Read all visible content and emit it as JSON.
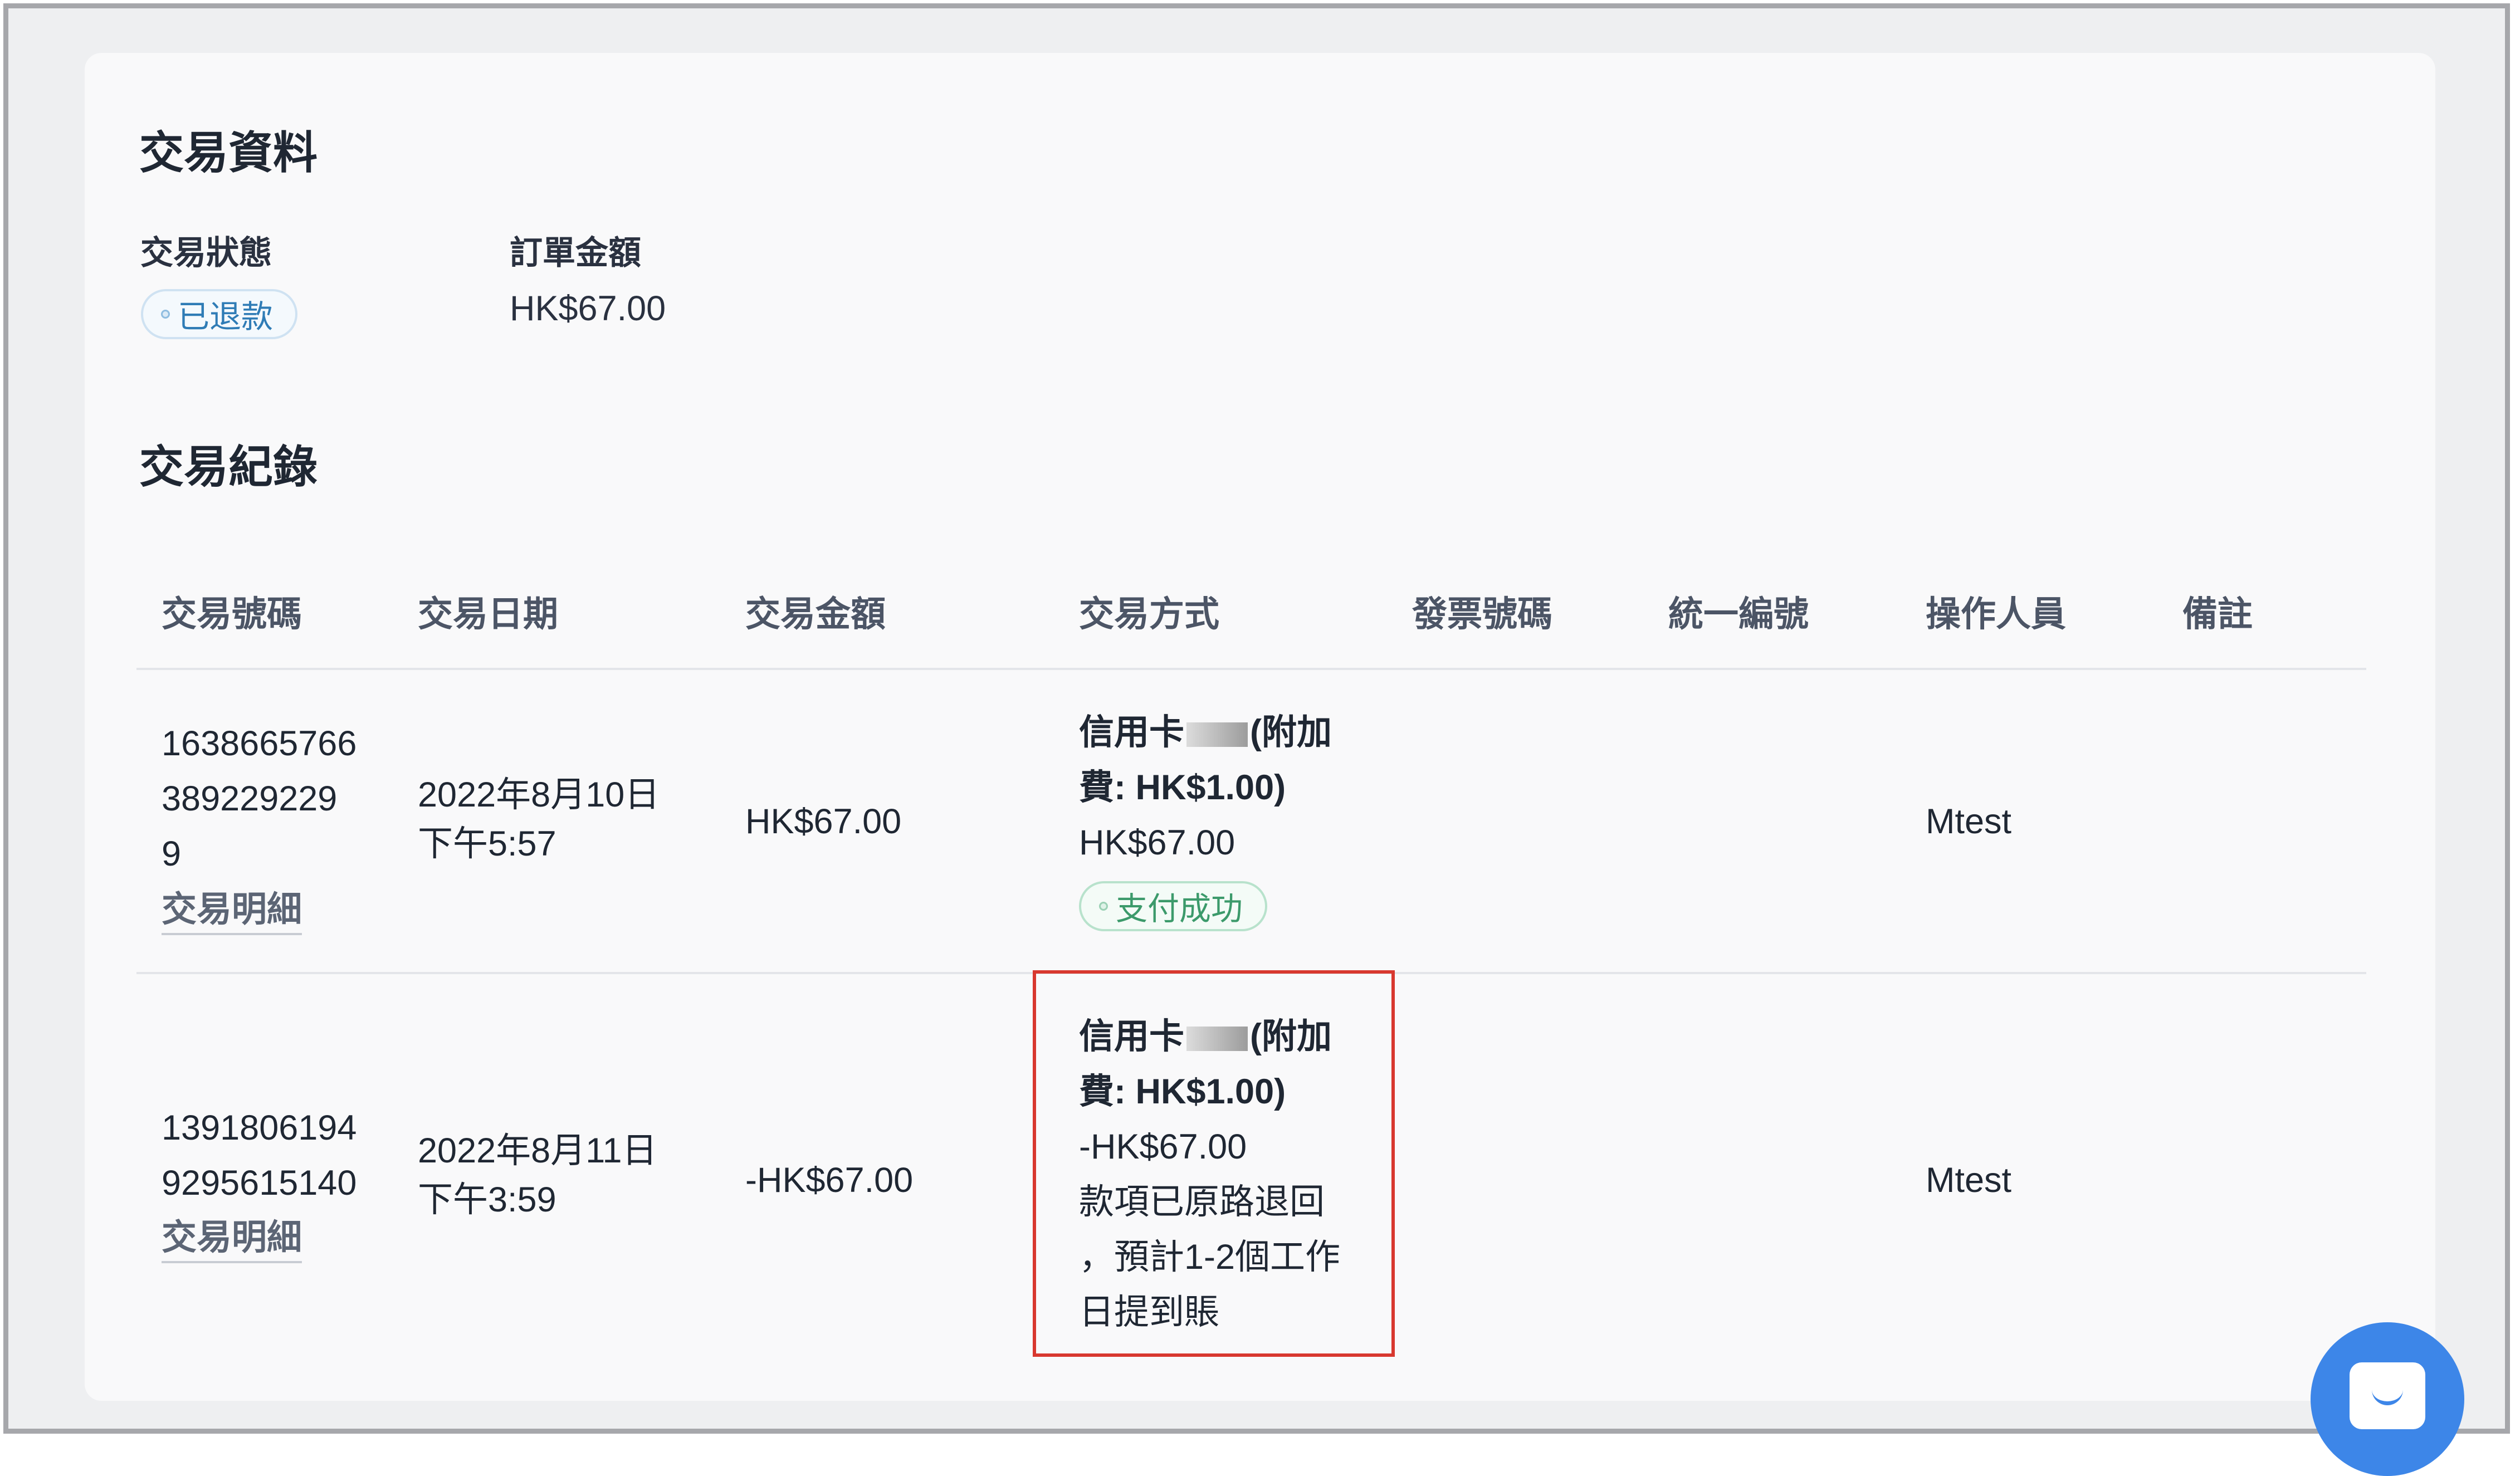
{
  "info": {
    "title": "交易資料",
    "status_label": "交易狀態",
    "status_value": "已退款",
    "amount_label": "訂單金額",
    "amount_value": "HK$67.00"
  },
  "records": {
    "title": "交易紀錄",
    "columns": [
      "交易號碼",
      "交易日期",
      "交易金額",
      "交易方式",
      "發票號碼",
      "統一編號",
      "操作人員",
      "備註"
    ],
    "rows": [
      {
        "id_line1": "1638665766",
        "id_line2": "389229229",
        "id_line3": "9",
        "detail_link": "交易明細",
        "date": "2022年8月10日",
        "time": "下午5:57",
        "amount": "HK$67.00",
        "method_prefix": "信用卡",
        "method_suffix": "(附加",
        "fee_line": "費: HK$1.00)",
        "method_amount": "HK$67.00",
        "method_status": "支付成功",
        "operator": "Mtest"
      },
      {
        "id_line1": "1391806194",
        "id_line2": "9295615140",
        "detail_link": "交易明細",
        "date": "2022年8月11日",
        "time": "下午3:59",
        "amount": "-HK$67.00",
        "method_prefix": "信用卡",
        "method_suffix": "(附加",
        "fee_line": "費: HK$1.00)",
        "method_amount": "-HK$67.00",
        "note_line1": "款項已原路退回",
        "note_line2": "，預計1-2個工作",
        "note_line3": "日提到賬",
        "operator": "Mtest"
      }
    ]
  },
  "colors": {
    "highlight": "#d8382f",
    "refunded": "#2f7cb6",
    "success": "#3c9a6b",
    "chat_button": "#3d86e8"
  },
  "icons": {
    "chat": "chat-bubble-icon"
  }
}
